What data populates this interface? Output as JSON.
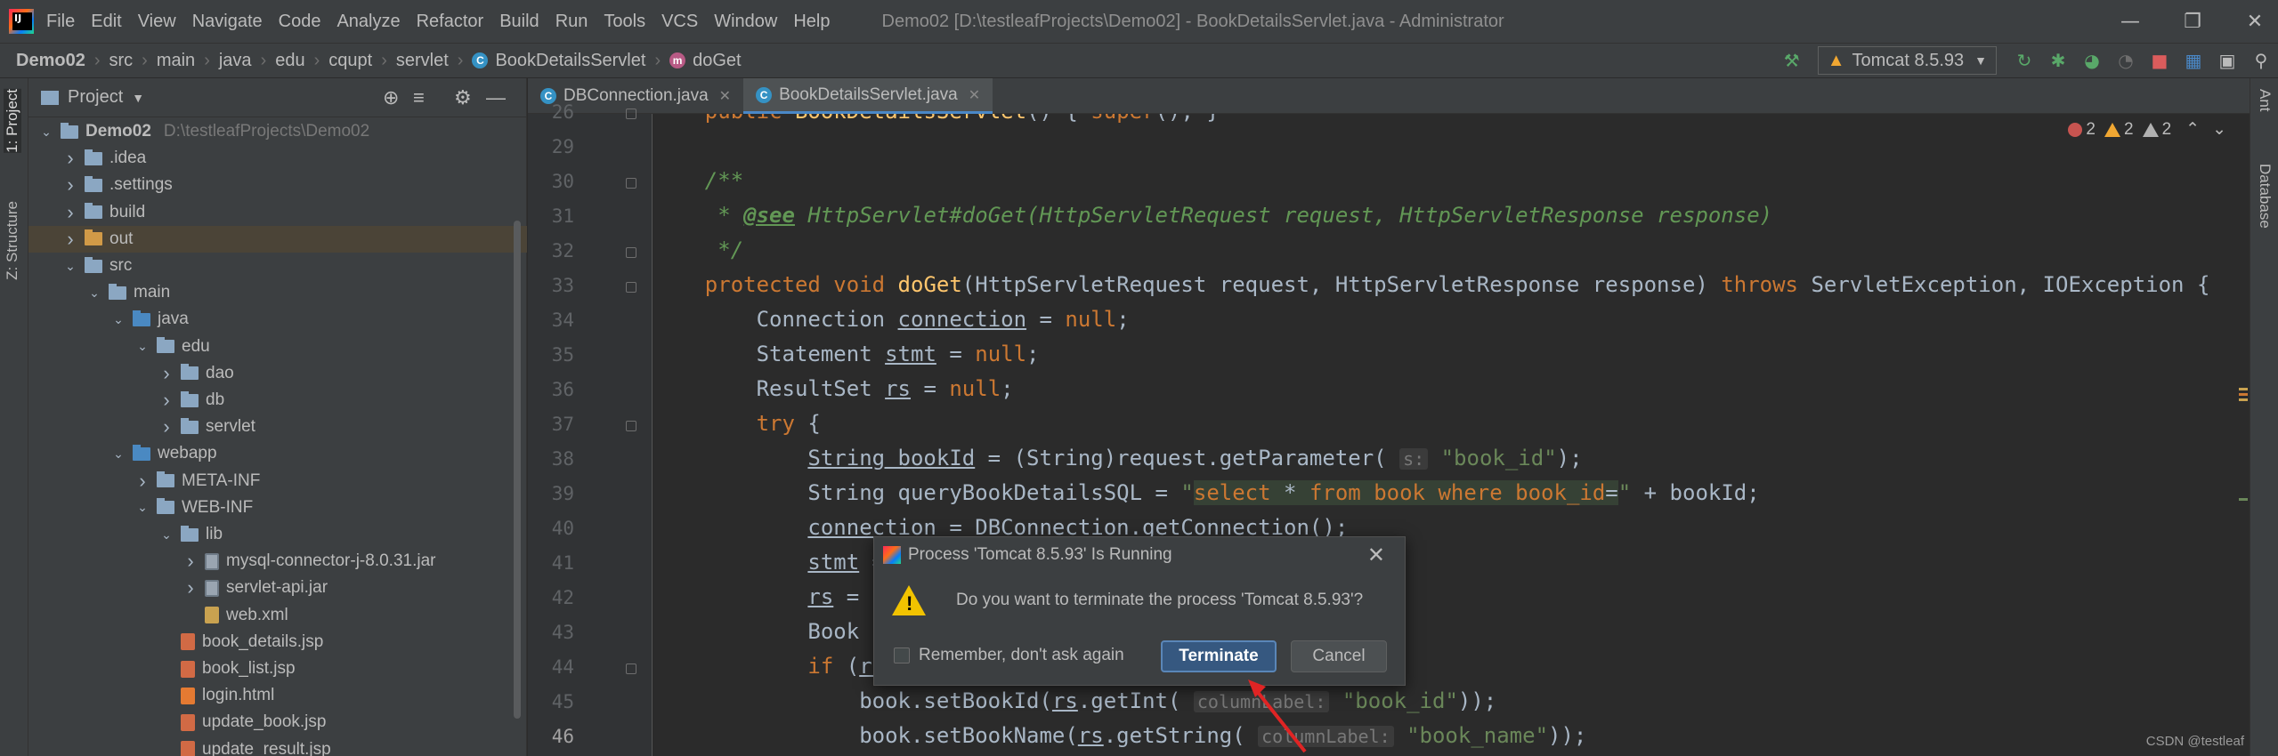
{
  "menu": {
    "items": [
      "File",
      "Edit",
      "View",
      "Navigate",
      "Code",
      "Analyze",
      "Refactor",
      "Build",
      "Run",
      "Tools",
      "VCS",
      "Window",
      "Help"
    ],
    "window_title": "Demo02 [D:\\testleafProjects\\Demo02] - BookDetailsServlet.java - Administrator"
  },
  "breadcrumb": [
    "Demo02",
    "src",
    "main",
    "java",
    "edu",
    "cqupt",
    "servlet",
    "BookDetailsServlet",
    "doGet"
  ],
  "run_config": "Tomcat 8.5.93",
  "left_stripe": {
    "project_tab": "1: Project",
    "structure_tab": "Z: Structure"
  },
  "right_stripe": {
    "ant_tab": "Ant",
    "database_tab": "Database"
  },
  "project": {
    "title": "Project",
    "tree": [
      {
        "label": "Demo02",
        "hint": "D:\\testleafProjects\\Demo02",
        "depth": 0,
        "arrow": "down",
        "icon": "folder",
        "bold": true
      },
      {
        "label": ".idea",
        "depth": 1,
        "arrow": "right",
        "icon": "folder"
      },
      {
        "label": ".settings",
        "depth": 1,
        "arrow": "right",
        "icon": "folder"
      },
      {
        "label": "build",
        "depth": 1,
        "arrow": "right",
        "icon": "folder"
      },
      {
        "label": "out",
        "depth": 1,
        "arrow": "right",
        "icon": "folder-orange",
        "selected": true
      },
      {
        "label": "src",
        "depth": 1,
        "arrow": "down",
        "icon": "folder"
      },
      {
        "label": "main",
        "depth": 2,
        "arrow": "down",
        "icon": "folder"
      },
      {
        "label": "java",
        "depth": 3,
        "arrow": "down",
        "icon": "folder-blue"
      },
      {
        "label": "edu",
        "depth": 4,
        "arrow": "down",
        "icon": "folder"
      },
      {
        "label": "dao",
        "depth": 5,
        "arrow": "right",
        "icon": "folder"
      },
      {
        "label": "db",
        "depth": 5,
        "arrow": "right",
        "icon": "folder"
      },
      {
        "label": "servlet",
        "depth": 5,
        "arrow": "right",
        "icon": "folder"
      },
      {
        "label": "webapp",
        "depth": 3,
        "arrow": "down",
        "icon": "folder-blue"
      },
      {
        "label": "META-INF",
        "depth": 4,
        "arrow": "right",
        "icon": "folder"
      },
      {
        "label": "WEB-INF",
        "depth": 4,
        "arrow": "down",
        "icon": "folder"
      },
      {
        "label": "lib",
        "depth": 5,
        "arrow": "down",
        "icon": "folder"
      },
      {
        "label": "mysql-connector-j-8.0.31.jar",
        "depth": 6,
        "arrow": "right",
        "icon": "jar"
      },
      {
        "label": "servlet-api.jar",
        "depth": 6,
        "arrow": "right",
        "icon": "jar"
      },
      {
        "label": "web.xml",
        "depth": 6,
        "arrow": "none",
        "icon": "xml"
      },
      {
        "label": "book_details.jsp",
        "depth": 5,
        "arrow": "none",
        "icon": "jsp"
      },
      {
        "label": "book_list.jsp",
        "depth": 5,
        "arrow": "none",
        "icon": "jsp"
      },
      {
        "label": "login.html",
        "depth": 5,
        "arrow": "none",
        "icon": "html"
      },
      {
        "label": "update_book.jsp",
        "depth": 5,
        "arrow": "none",
        "icon": "jsp"
      },
      {
        "label": "update_result.jsp",
        "depth": 5,
        "arrow": "none",
        "icon": "jsp"
      }
    ]
  },
  "editor": {
    "tabs": [
      {
        "label": "DBConnection.java",
        "active": false
      },
      {
        "label": "BookDetailsServlet.java",
        "active": true
      }
    ],
    "inspections": {
      "errors": "2",
      "warnings": "2",
      "weak_warnings": "2"
    },
    "lines": [
      {
        "no": "26",
        "html": "    <span class=\"kw\">public</span> <span class=\"fn\">BookDetailsServlet</span>() { <span class=\"kw\">super</span>(); }"
      },
      {
        "no": "29",
        "html": ""
      },
      {
        "no": "30",
        "html": "    <span class=\"doc\">/**</span>"
      },
      {
        "no": "31",
        "html": "<span class=\"doc\">     * </span><span class=\"doctag\">@see</span><span class=\"doc\"> HttpServlet#doGet(HttpServletRequest request, HttpServletResponse response)</span>"
      },
      {
        "no": "32",
        "html": "<span class=\"doc\">     */</span>"
      },
      {
        "no": "33",
        "html": "    <span class=\"kw\">protected void</span> <span class=\"fn\">doGet</span>(HttpServletRequest request, HttpServletResponse response) <span class=\"kw\">throws</span> ServletException, IOException {"
      },
      {
        "no": "34",
        "html": "        Connection <span class=\"ul\">connection</span> = <span class=\"kw\">null</span>;"
      },
      {
        "no": "35",
        "html": "        Statement <span class=\"ul\">stmt</span> = <span class=\"kw\">null</span>;"
      },
      {
        "no": "36",
        "html": "        ResultSet <span class=\"ul\">rs</span> = <span class=\"kw\">null</span>;"
      },
      {
        "no": "37",
        "html": "        <span class=\"kw\">try</span> {"
      },
      {
        "no": "38",
        "html": "            <span class=\"ul\">String bookId</span> = (String)request.getParameter( <span class=\"hint\">s:</span> <span class=\"str\">\"book_id\"</span>);"
      },
      {
        "no": "39",
        "html": "            String queryBookDetailsSQL = <span class=\"str\">\"</span><span class=\"sqlbg\"><span class=\"sqlkw\">select</span> * <span class=\"sqlkw\">from</span> <span class=\"sqlkw\">book</span> <span class=\"sqlkw\">where</span> <span class=\"sqlkw\">book_id</span>=</span><span class=\"str\">\"</span> + bookId;"
      },
      {
        "no": "40",
        "html": "            <span class=\"ul\">connection</span> = DBConnection.getConnection();"
      },
      {
        "no": "41",
        "html": "            <span class=\"ul\">stmt</span> = connection.createStatement();"
      },
      {
        "no": "42",
        "html": "            <span class=\"ul\">rs</span> = stmt.executeQuery(queryBookDetailsSQL);"
      },
      {
        "no": "43",
        "html": "            Book book = <span class=\"kw\">new</span> Book();"
      },
      {
        "no": "44",
        "html": "            <span class=\"kw\">if</span> (<span class=\"ul\">rs</span>.next()) {"
      },
      {
        "no": "45",
        "html": "                book.setBookId(<span class=\"ul\">rs</span>.getInt( <span class=\"hint\">columnLabel:</span> <span class=\"str\">\"book_id\"</span>));"
      },
      {
        "no": "46",
        "html": "                book.setBookName(<span class=\"ul\">rs</span>.getString( <span class=\"hint\">columnLabel:</span> <span class=\"str\">\"book_name\"</span>));"
      }
    ]
  },
  "dialog": {
    "title": "Process 'Tomcat 8.5.93' Is Running",
    "message": "Do you want to terminate the process 'Tomcat 8.5.93'?",
    "remember_label": "Remember, don't ask again",
    "terminate_label": "Terminate",
    "cancel_label": "Cancel"
  },
  "watermark": "CSDN @testleaf",
  "colors": {
    "background": "#2b2b2b",
    "panel": "#3c3f41",
    "keyword": "#cc7832",
    "method": "#ffc66d",
    "string": "#6a8759",
    "accent": "#4a88c7",
    "annotation_arrow": "#e02424"
  }
}
